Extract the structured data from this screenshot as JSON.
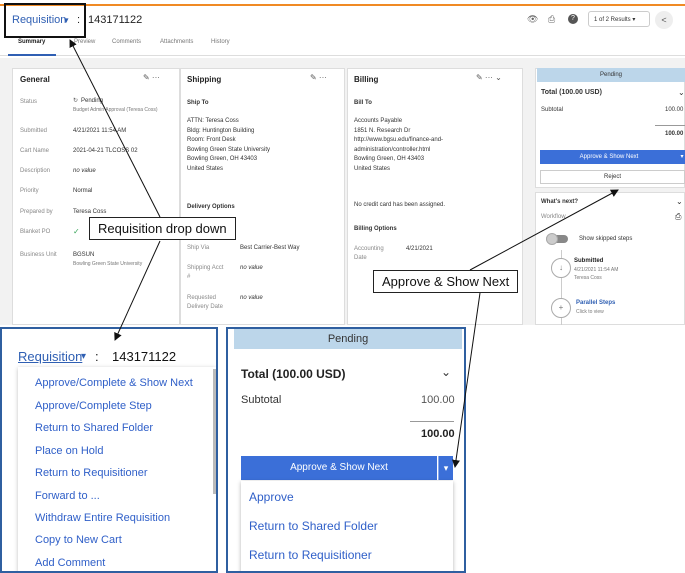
{
  "header": {
    "title": "Requisition",
    "colon": ":",
    "number": "143171122",
    "results": "1 of 2 Results",
    "back": "<"
  },
  "tabs": [
    "Summary",
    "Preview",
    "Comments",
    "Attachments",
    "History"
  ],
  "general": {
    "heading": "General",
    "rows": [
      {
        "label": "Status",
        "value": "Pending",
        "sub": "Budget Admin Approval (Teresa Coss)"
      },
      {
        "label": "Submitted",
        "value": "4/21/2021 11:54 AM"
      },
      {
        "label": "Cart Name",
        "value": "2021-04-21 TLCOSS 02"
      },
      {
        "label": "Description",
        "value": "no value"
      },
      {
        "label": "Priority",
        "value": "Normal"
      },
      {
        "label": "Prepared by",
        "value": "Teresa Coss"
      },
      {
        "label": "Blanket PO",
        "value": "✓"
      },
      {
        "label": "Business Unit",
        "value": "BGSUN",
        "sub": "Bowling Green State University"
      }
    ]
  },
  "shipping": {
    "heading": "Shipping",
    "ship_to": "Ship To",
    "address": [
      "ATTN: Teresa Coss",
      "Bldg: Huntington Building",
      "Room: Front Desk",
      "Bowling Green State University",
      "Bowling Green, OH 43403",
      "United States"
    ],
    "delivery_options": "Delivery Options",
    "ship_via_label": "Ship Via",
    "ship_via_value": "Best Carrier-Best Way",
    "acct_label": "Shipping Acct",
    "acct_label2": "#",
    "acct_value": "no value",
    "req_label": "Requested",
    "req_label2": "Delivery Date",
    "req_value": "no value"
  },
  "billing": {
    "heading": "Billing",
    "bill_to": "Bill To",
    "address": [
      "Accounts Payable",
      "1851 N. Research Dr",
      "http://www.bgsu.edu/finance-and-",
      "administration/controller.html",
      "Bowling Green, OH 43403",
      "United States"
    ],
    "no_card": "No credit card has been assigned.",
    "billing_options": "Billing Options",
    "acct_label": "Accounting",
    "acct_label2": "Date",
    "acct_value": "4/21/2021"
  },
  "approval": {
    "status": "Pending",
    "total_label": "Total (100.00 USD)",
    "subtotal_label": "Subtotal",
    "subtotal_value": "100.00",
    "total_value": "100.00",
    "approve_label": "Approve & Show Next",
    "reject_label": "Reject",
    "whats_next": "What's next?",
    "workflow": "Workflow",
    "show_skipped": "Show skipped steps",
    "step1_title": "Submitted",
    "step1_date": "4/21/2021 11:54 AM",
    "step1_user": "Teresa Coss",
    "step2_title": "Parallel Steps",
    "step2_sub": "Click to view"
  },
  "callouts": {
    "dropdown": "Requisition drop down",
    "approve": "Approve & Show Next"
  },
  "dropdown_menu": [
    "Approve/Complete & Show Next",
    "Approve/Complete Step",
    "Return to Shared Folder",
    "Place on Hold",
    "Return to Requisitioner",
    "Forward to ...",
    "Withdraw Entire Requisition",
    "Copy to New Cart",
    "Add Comment"
  ],
  "approve_menu": [
    "Approve",
    "Return to Shared Folder",
    "Return to Requisitioner"
  ],
  "colors": {
    "accent": "#3b6fd8",
    "link": "#2f5fb3",
    "pending_bg": "#bcd6ea",
    "orange": "#f08a24"
  }
}
